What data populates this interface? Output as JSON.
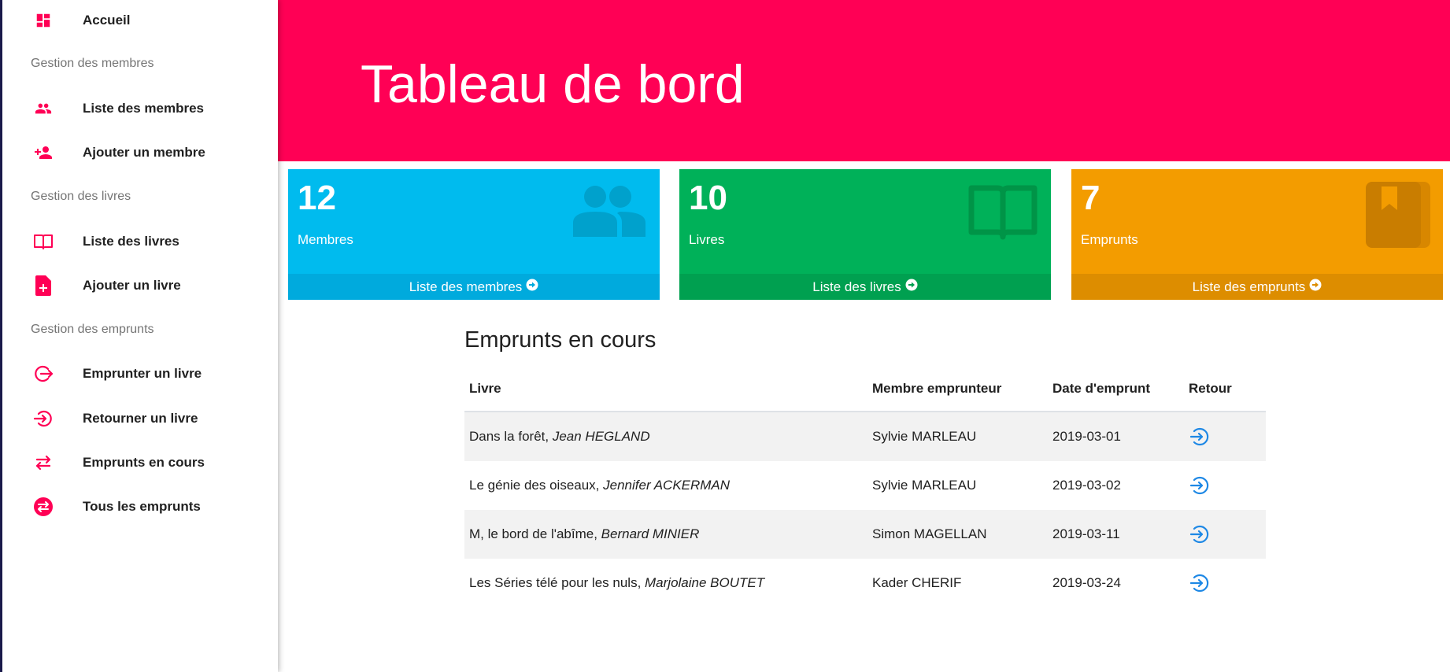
{
  "sidebar": {
    "home": "Accueil",
    "sections": [
      {
        "title": "Gestion des membres",
        "items": [
          {
            "label": "Liste des membres",
            "icon": "people-icon"
          },
          {
            "label": "Ajouter un membre",
            "icon": "person-add-icon"
          }
        ]
      },
      {
        "title": "Gestion des livres",
        "items": [
          {
            "label": "Liste des livres",
            "icon": "book-open-icon"
          },
          {
            "label": "Ajouter un livre",
            "icon": "file-add-icon"
          }
        ]
      },
      {
        "title": "Gestion des emprunts",
        "items": [
          {
            "label": "Emprunter un livre",
            "icon": "sign-out-icon"
          },
          {
            "label": "Retourner un livre",
            "icon": "sign-in-icon"
          },
          {
            "label": "Emprunts en cours",
            "icon": "swap-arrows-icon"
          },
          {
            "label": "Tous les emprunts",
            "icon": "swap-circle-icon"
          }
        ]
      }
    ]
  },
  "header": {
    "title": "Tableau de bord",
    "color": "#ff0055"
  },
  "cards": [
    {
      "count": "12",
      "label": "Membres",
      "link": "Liste des membres",
      "color": "#00bbee",
      "footer_color": "#00aadd",
      "icon": "people-icon"
    },
    {
      "count": "10",
      "label": "Livres",
      "link": "Liste des livres",
      "color": "#00b159",
      "footer_color": "#00a050",
      "icon": "book-open-icon"
    },
    {
      "count": "7",
      "label": "Emprunts",
      "link": "Liste des emprunts",
      "color": "#f39c00",
      "footer_color": "#dd8d00",
      "icon": "bookmark-book-icon"
    }
  ],
  "loans": {
    "title": "Emprunts en cours",
    "columns": [
      "Livre",
      "Membre emprunteur",
      "Date d'emprunt",
      "Retour"
    ],
    "rows": [
      {
        "book": "Dans la forêt, ",
        "author": "Jean HEGLAND",
        "member": "Sylvie  MARLEAU",
        "date": "2019-03-01"
      },
      {
        "book": "Le génie des oiseaux, ",
        "author": "Jennifer ACKERMAN",
        "member": "Sylvie  MARLEAU",
        "date": "2019-03-02"
      },
      {
        "book": "M, le bord de l'abîme, ",
        "author": "Bernard MINIER",
        "member": "Simon  MAGELLAN",
        "date": "2019-03-11"
      },
      {
        "book": "Les Séries télé pour les nuls, ",
        "author": "Marjolaine BOUTET",
        "member": "Kader  CHERIF",
        "date": "2019-03-24"
      }
    ]
  },
  "colors": {
    "accent": "#ff0055",
    "return_icon": "#1e88e5"
  }
}
